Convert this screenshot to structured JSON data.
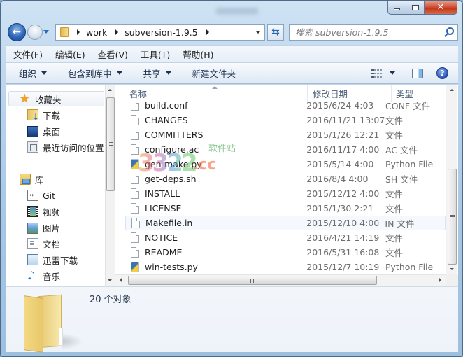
{
  "window": {
    "title_blurred": true,
    "caption_buttons": {
      "minimize": "minimize",
      "maximize": "maximize",
      "close": "✕"
    }
  },
  "nav": {
    "back_icon": "back-arrow-icon",
    "forward_icon": "forward-arrow-icon",
    "breadcrumb": [
      "work",
      "subversion-1.9.5"
    ],
    "search_placeholder": "搜索 subversion-1.9.5"
  },
  "menu": {
    "items": [
      "文件(F)",
      "编辑(E)",
      "查看(V)",
      "工具(T)",
      "帮助(H)"
    ]
  },
  "toolbar": {
    "organize": "组织",
    "include_in_library": "包含到库中",
    "share": "共享",
    "new_folder": "新建文件夹",
    "help": "?"
  },
  "sidebar": {
    "favorites": {
      "label": "收藏夹",
      "items": [
        "下载",
        "桌面",
        "最近访问的位置"
      ]
    },
    "libraries": {
      "label": "库",
      "items": [
        "Git",
        "视频",
        "图片",
        "文档",
        "迅雷下载",
        "音乐"
      ]
    }
  },
  "file_list": {
    "columns": {
      "name": "名称",
      "date": "修改日期",
      "type": "类型"
    },
    "rows": [
      {
        "name": "build.conf",
        "date": "2015/6/24 4:03",
        "type": "CONF 文件",
        "icon": "file"
      },
      {
        "name": "CHANGES",
        "date": "2016/11/21 13:07",
        "type": "文件",
        "icon": "file"
      },
      {
        "name": "COMMITTERS",
        "date": "2015/1/26 12:21",
        "type": "文件",
        "icon": "file"
      },
      {
        "name": "configure.ac",
        "date": "2016/11/17 4:00",
        "type": "AC 文件",
        "icon": "file"
      },
      {
        "name": "gen-make.py",
        "date": "2015/5/14 4:00",
        "type": "Python File",
        "icon": "python"
      },
      {
        "name": "get-deps.sh",
        "date": "2016/8/4 4:00",
        "type": "SH 文件",
        "icon": "file"
      },
      {
        "name": "INSTALL",
        "date": "2015/12/12 4:00",
        "type": "文件",
        "icon": "file"
      },
      {
        "name": "LICENSE",
        "date": "2015/1/30 2:21",
        "type": "文件",
        "icon": "file"
      },
      {
        "name": "Makefile.in",
        "date": "2015/12/10 4:00",
        "type": "IN 文件",
        "icon": "file"
      },
      {
        "name": "NOTICE",
        "date": "2016/4/21 14:19",
        "type": "文件",
        "icon": "file"
      },
      {
        "name": "README",
        "date": "2016/5/31 16:08",
        "type": "文件",
        "icon": "file"
      },
      {
        "name": "win-tests.py",
        "date": "2015/12/7 10:19",
        "type": "Python File",
        "icon": "python"
      }
    ],
    "hovered_row": "Makefile.in"
  },
  "watermark": {
    "number": "3322",
    "domain": ".cc",
    "label": "软件站"
  },
  "details": {
    "object_count": "20 个对象"
  }
}
